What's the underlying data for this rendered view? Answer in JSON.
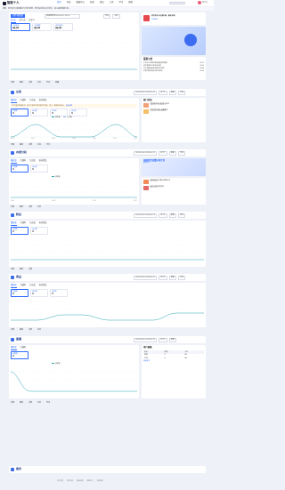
{
  "app": {
    "brand": "智能个人",
    "user": "用户名"
  },
  "nav": [
    "首页",
    "内容",
    "数据中心",
    "粉丝",
    "商品",
    "工具",
    "学习",
    "帮助"
  ],
  "notice": "通知：创作者平台数据统计口径已更新，部分指标将在次日同步，请以最新数据为准。",
  "overview": {
    "title": "创作者数据",
    "tabs": [
      "近7天",
      "近30天",
      "自定义"
    ],
    "filter": "数据更新至2023-09-12 24:00",
    "buttons": [
      "导出",
      "对比"
    ],
    "stats": [
      {
        "label": "今日收益",
        "value": "¥0.00",
        "sub": "较昨日 -- "
      },
      {
        "label": "今日播放",
        "value": "¥0.00",
        "sub": "较昨日 -- "
      },
      {
        "label": "近7日收益",
        "value": "¥0.00",
        "sub": "较昨日 -- "
      }
    ]
  },
  "promo": {
    "title": "创作者平台全面升级，精彩来袭",
    "badge": "立即体验"
  },
  "notice_panel": {
    "title": "最新公告",
    "items": [
      "平台关于加强内容质量管理的通知",
      "创作者激励计划升级说明",
      "关于数据看板新增指标的说明",
      "优质内容评选活动开启报名"
    ],
    "dates": [
      "09-12",
      "09-10",
      "09-08",
      "09-05"
    ]
  },
  "sections": [
    {
      "key": "overview2",
      "title": "总览",
      "date": "2023-09-06~2023-09-12",
      "period": "近7天"
    },
    {
      "key": "content",
      "title": "内容分析",
      "date": "2023-09-06~2023-09-12",
      "period": "近7天"
    },
    {
      "key": "fans",
      "title": "粉丝",
      "date": "2023-09-06~2023-09-12",
      "period": "近7天"
    },
    {
      "key": "goods",
      "title": "商品",
      "date": "2023-09-06~2023-09-12",
      "period": "近7天"
    },
    {
      "key": "live",
      "title": "直播",
      "date": "2023-09-06~2023-09-12",
      "period": "近7天"
    },
    {
      "key": "service",
      "title": "服务",
      "date": "2023-09-06~2023-09-12",
      "period": "近7天"
    }
  ],
  "section_tabs": [
    "播放量",
    "完播率",
    "互动量",
    "粉丝增量"
  ],
  "section_buttons": [
    "数据",
    "导出",
    "更多"
  ],
  "row_labels": [
    "日期",
    "播放",
    "点赞",
    "评论",
    "分享",
    "收藏"
  ],
  "legend": [
    "播放量",
    "互动量"
  ],
  "hint": "近7天暂无数据变化，建议多发布优质内容提升曝光，提示：数据存在延迟。",
  "hint_link": "查看攻略",
  "stat_cards": [
    {
      "label": "总播放",
      "value": "0",
      "sub": "较上期 0%"
    },
    {
      "label": "总点赞",
      "value": "0",
      "sub": "较上期 0%"
    },
    {
      "label": "总评论",
      "value": "0",
      "sub": "较上期 0%"
    },
    {
      "label": "总分享",
      "value": "0",
      "sub": "较上期 0%"
    }
  ],
  "x_ticks": [
    "09-06",
    "09-07",
    "09-08",
    "09-09",
    "09-10",
    "09-11",
    "09-12"
  ],
  "side": {
    "activity_title": "热门活动",
    "activities": [
      {
        "title": "创作者扶持计划·新人专享",
        "sub": "活动时间：09-01至09-30"
      },
      {
        "title": "优质内容激励·流量翻倍",
        "sub": "活动时间：09-05至09-25"
      }
    ],
    "banner": {
      "title": "直播带货流量扶持计划",
      "sub": "报名参与"
    },
    "activity2": [
      {
        "title": "短视频创作大赛火热进行中",
        "sub": "截止：09-30"
      },
      {
        "title": "粉丝互动专项活动",
        "sub": "截止：09-28"
      }
    ],
    "table_title": "用户画像",
    "table_head": [
      "指标",
      "数值",
      "占比"
    ],
    "table_rows": [
      [
        "男性",
        "0",
        "0%"
      ],
      [
        "女性",
        "0",
        "0%"
      ]
    ],
    "more": "查看更多"
  },
  "footer": [
    "关于我们",
    "用户协议",
    "隐私政策",
    "帮助中心",
    "联系我们"
  ],
  "colors": {
    "primary": "#2f6bff",
    "teal": "#2ba6b0",
    "title": "#1f3a8a"
  }
}
